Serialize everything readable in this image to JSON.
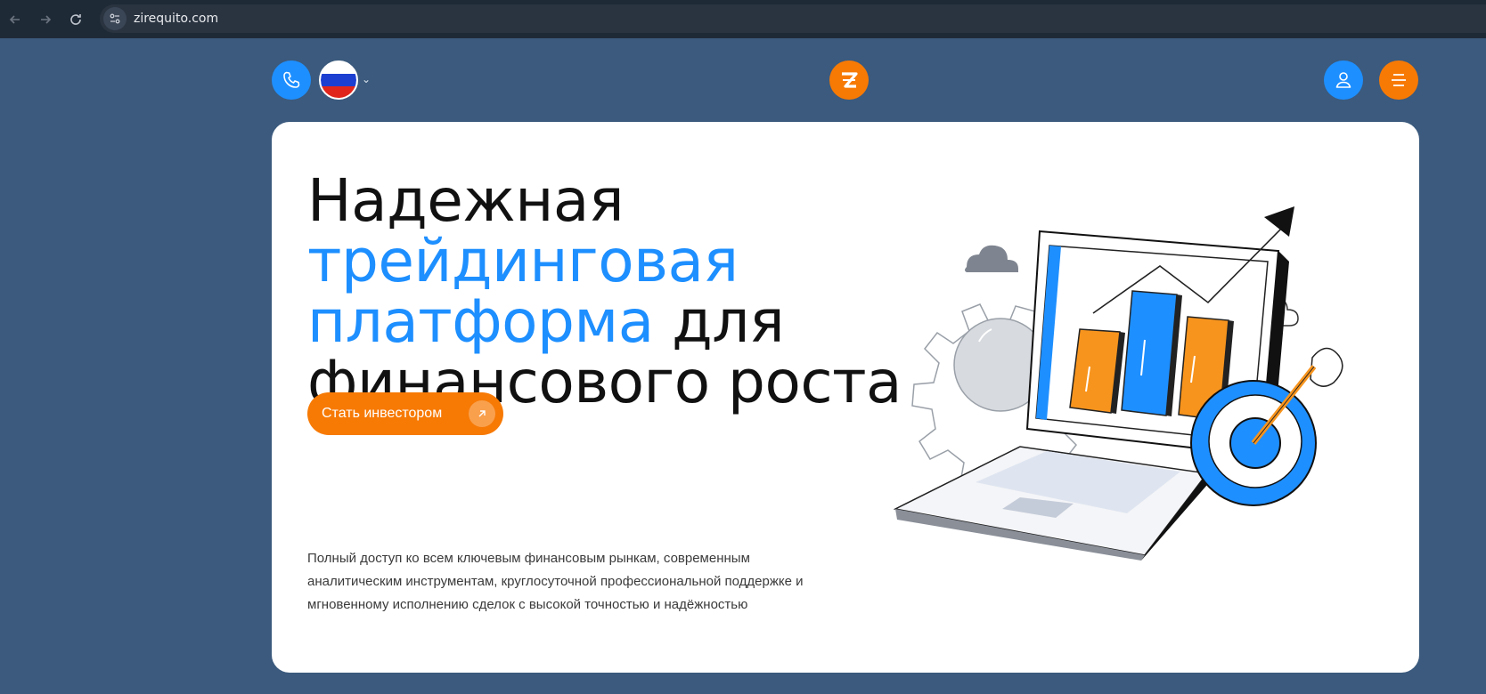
{
  "browser": {
    "url": "zirequito.com"
  },
  "header": {
    "logo_letter": "Z",
    "language": "ru"
  },
  "hero": {
    "title_part1": "Надежная ",
    "title_accent": "трейдинговая платформа",
    "title_part2": " для финансового роста",
    "cta_label": "Стать инвестором",
    "description": "Полный доступ ко всем ключевым финансовым рынкам, современным аналитическим инструментам, круглосуточной профессиональной поддержке и мгновенному исполнению сделок с высокой точностью и надёжностью"
  },
  "colors": {
    "page_bg": "#3b5a7d",
    "accent_blue": "#1e8fff",
    "accent_orange": "#f77a05"
  }
}
